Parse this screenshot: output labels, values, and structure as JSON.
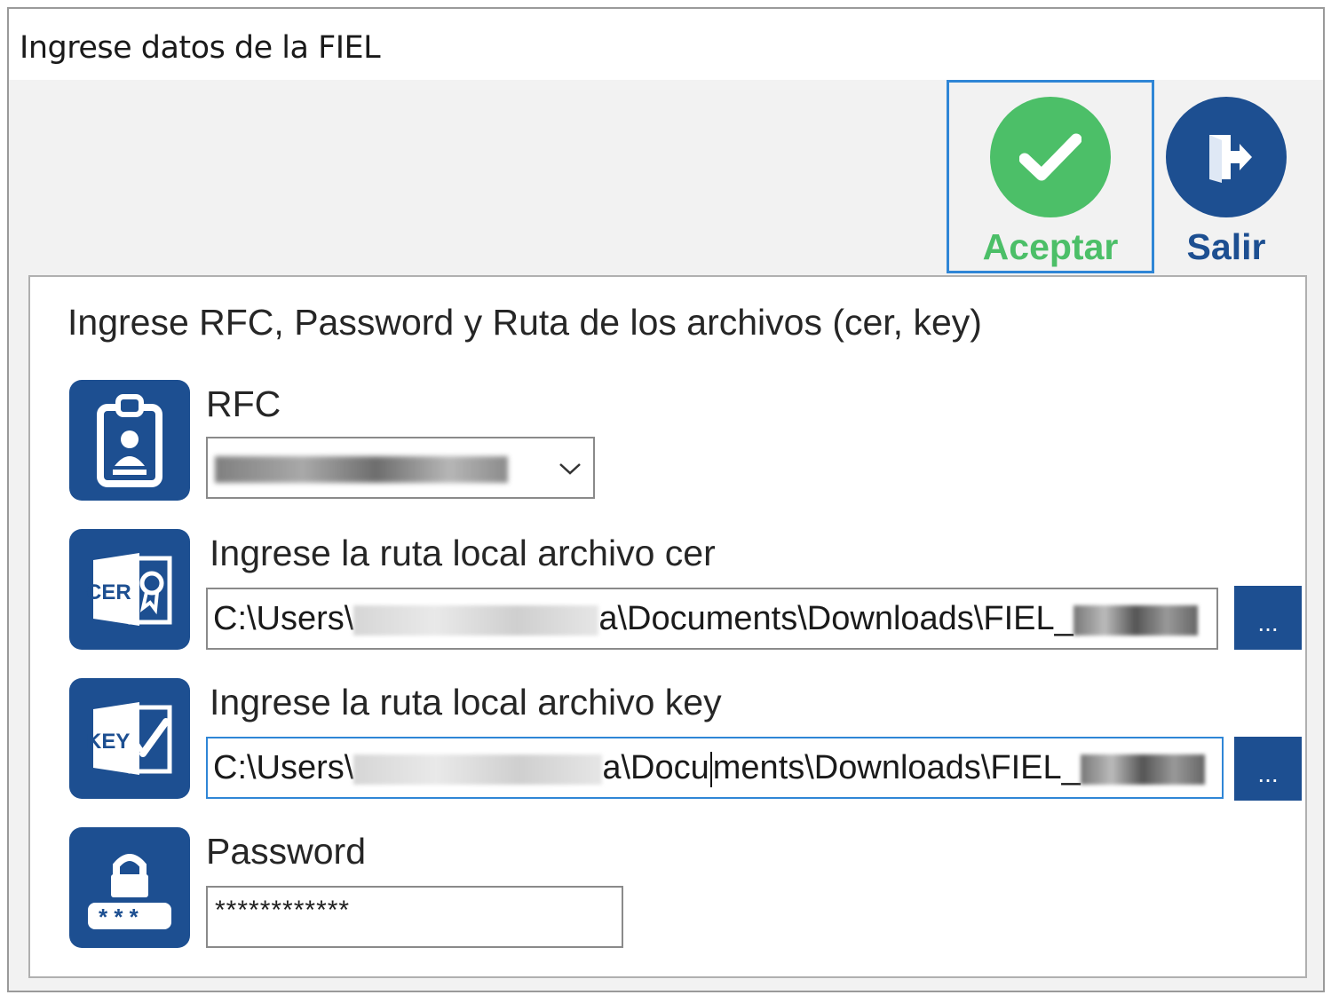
{
  "window": {
    "title": "Ingrese datos de la FIEL"
  },
  "toolbar": {
    "accept_label": "Aceptar",
    "exit_label": "Salir",
    "accept_color": "#4cbf68",
    "exit_color": "#1d4f91"
  },
  "panel": {
    "heading": "Ingrese RFC, Password y Ruta de los archivos (cer, key)",
    "rfc": {
      "label": "RFC"
    },
    "cer": {
      "label": "Ingrese la ruta local archivo cer",
      "path_prefix": "C:\\Users\\",
      "path_middle": "a\\Documents\\Downloads\\FIEL_",
      "browse_label": "..."
    },
    "key": {
      "label": "Ingrese la ruta local archivo key",
      "path_prefix": "C:\\Users\\",
      "path_middle_a": "a\\Docu",
      "path_middle_b": "ments\\Downloads\\FIEL_",
      "browse_label": "..."
    },
    "password": {
      "label": "Password",
      "value": "************"
    }
  },
  "icons": {
    "rfc": "id-badge-icon",
    "cer": "certificate-file-icon",
    "key": "key-file-icon",
    "password": "lock-password-icon",
    "accept": "checkmark-icon",
    "exit": "exit-door-icon"
  },
  "colors": {
    "brand_blue": "#1d4f91",
    "focus_blue": "#2f86d6",
    "accept_green": "#4cbf68"
  }
}
